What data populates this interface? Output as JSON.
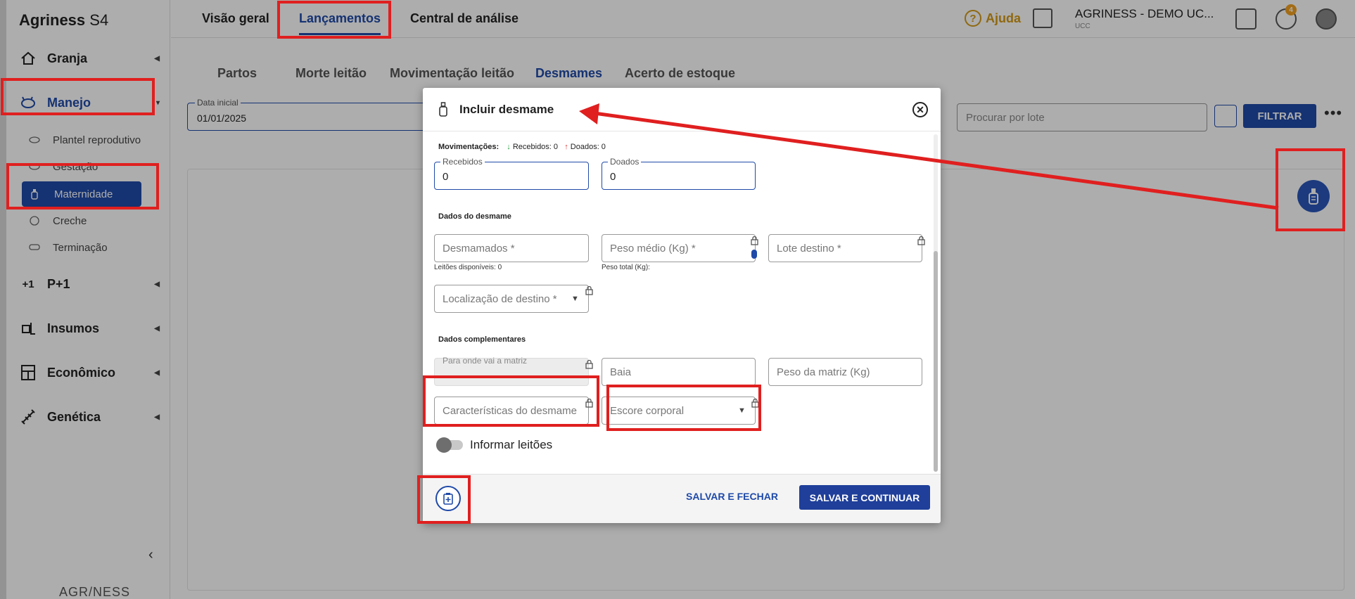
{
  "app": {
    "brand": "Agriness",
    "brand_suffix": "S4",
    "footer_logo": "AGR/NESS"
  },
  "sidebar": {
    "items": [
      {
        "label": "Granja"
      },
      {
        "label": "Manejo"
      },
      {
        "label": "P+1"
      },
      {
        "label": "Insumos"
      },
      {
        "label": "Econômico"
      },
      {
        "label": "Genética"
      }
    ],
    "subitems": [
      {
        "label": "Plantel reprodutivo"
      },
      {
        "label": "Gestação"
      },
      {
        "label": "Maternidade"
      },
      {
        "label": "Creche"
      },
      {
        "label": "Terminação"
      }
    ],
    "collapse": "‹"
  },
  "topbar": {
    "tabs": [
      "Visão geral",
      "Lançamentos",
      "Central de análise"
    ],
    "help": "Ajuda",
    "company": "AGRINESS - DEMO UC...",
    "company_sub": "UCC",
    "notif_count": "4"
  },
  "subtabs": [
    "Partos",
    "Morte leitão",
    "Movimentação leitão",
    "Desmames",
    "Acerto de estoque"
  ],
  "filters": {
    "date_label": "Data inicial",
    "date_value": "01/01/2025",
    "lote_placeholder": "Procurar por lote",
    "filter_button": "FILTRAR",
    "more": "•••"
  },
  "modal": {
    "title": "Incluir desmame",
    "movimentacoes_label": "Movimentações:",
    "recebidos_summary": "Recebidos: 0",
    "doados_summary": "Doados: 0",
    "recebidos_label": "Recebidos",
    "recebidos_value": "0",
    "doados_label": "Doados",
    "doados_value": "0",
    "section_desmame": "Dados do desmame",
    "desmamados": "Desmamados *",
    "peso_medio": "Peso médio (Kg) *",
    "lote_destino": "Lote destino *",
    "leitoes_disponiveis": "Leitões disponíveis: 0",
    "peso_total": "Peso total (Kg):",
    "localizacao": "Localização de destino *",
    "section_complementares": "Dados complementares",
    "para_onde": "Para onde vai a matriz",
    "baia": "Baia",
    "peso_matriz": "Peso da matriz (Kg)",
    "caracteristicas": "Características do desmame",
    "escore": "Escore corporal",
    "toggle_label": "Informar leitões",
    "save_close": "SALVAR E FECHAR",
    "save_continue": "SALVAR E CONTINUAR"
  },
  "colors": {
    "primary": "#1f4aa8",
    "annotation": "#e01f1f",
    "help": "#d39a16"
  },
  "icons": [
    "pig-icon",
    "home-icon",
    "lock-icon",
    "bottle-icon",
    "close-icon",
    "calendar-icon",
    "attach-note-icon"
  ]
}
